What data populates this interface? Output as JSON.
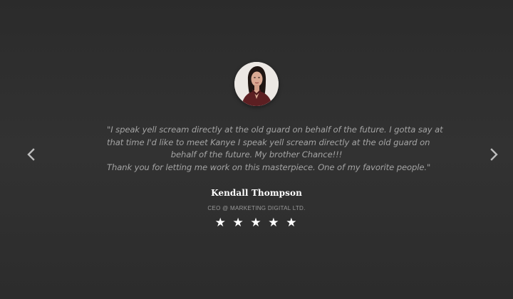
{
  "testimonial": {
    "quote_lines": [
      "\"I speak yell scream directly at the old guard on behalf of the future. I gotta say at",
      "that time I'd like to meet Kanye I speak yell scream directly at the old guard on",
      "behalf of the future. My brother Chance!!!",
      "Thank you for letting me work on this masterpiece. One of my favorite people.\""
    ],
    "name": "Kendall Thompson",
    "role": "CEO @ MARKETING DIGITAL LTD.",
    "rating": 5,
    "stars": [
      "★",
      "★",
      "★",
      "★",
      "★"
    ]
  },
  "nav": {
    "prev_icon": "chevron-left-icon",
    "next_icon": "chevron-right-icon"
  },
  "colors": {
    "background": "#2e2e2e",
    "quote_text": "#a4a4a4",
    "name_text": "#ffffff",
    "role_text": "#9a9a9a",
    "star": "#ffffff"
  }
}
